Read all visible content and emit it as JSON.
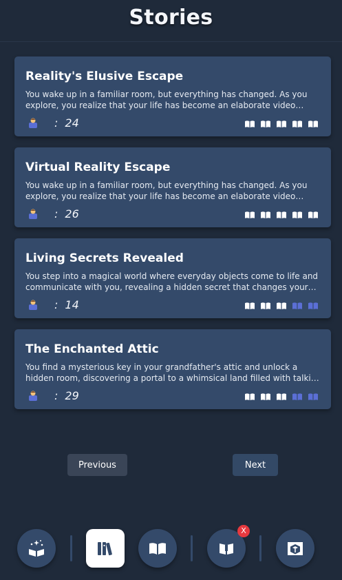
{
  "page": {
    "title": "Stories"
  },
  "stories": [
    {
      "title": "Reality's Elusive Escape",
      "description": "You wake up in a familiar room, but everything has changed. As you explore, you realize that your life has become an elaborate video game, and your…",
      "separator": ":",
      "count": "24",
      "rating_filled": 5,
      "rating_total": 5
    },
    {
      "title": "Virtual Reality Escape",
      "description": "You wake up in a familiar room, but everything has changed. As you explore, you realize that your life has become an elaborate video game, and your…",
      "separator": ":",
      "count": "26",
      "rating_filled": 5,
      "rating_total": 5
    },
    {
      "title": "Living Secrets Revealed",
      "description": "You step into a magical world where everyday objects come to life and communicate with you, revealing a hidden secret that changes your…",
      "separator": ":",
      "count": "14",
      "rating_filled": 3,
      "rating_total": 5
    },
    {
      "title": "The Enchanted Attic",
      "description": "You find a mysterious key in your grandfather's attic and unlock a hidden room, discovering a portal to a whimsical land filled with talking animals and…",
      "separator": ":",
      "count": "29",
      "rating_filled": 3,
      "rating_total": 5
    }
  ],
  "pagination": {
    "previous_label": "Previous",
    "next_label": "Next"
  },
  "bottom_nav": {
    "items": [
      {
        "icon": "magic-book-icon",
        "active": false
      },
      {
        "icon": "library-icon",
        "active": true
      },
      {
        "icon": "open-book-icon",
        "active": false
      },
      {
        "icon": "book-badge-icon",
        "active": false,
        "badge": "X"
      },
      {
        "icon": "box-book-icon",
        "active": false
      }
    ]
  },
  "colors": {
    "background": "#1f2a3a",
    "card": "#344a6a",
    "rating_filled": "#ffffff",
    "rating_empty": "#5b6fd6",
    "badge": "#e6393f",
    "active_nav": "#ffffff"
  }
}
